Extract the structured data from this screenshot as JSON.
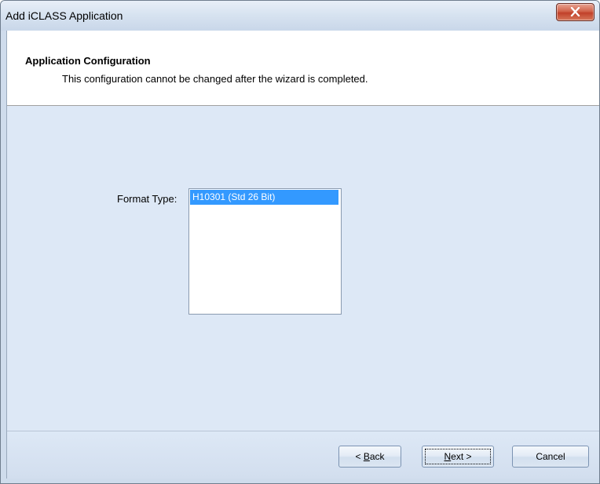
{
  "window": {
    "title": "Add iCLASS Application"
  },
  "header": {
    "title": "Application Configuration",
    "subtitle": "This configuration cannot be changed after the wizard is completed."
  },
  "form": {
    "format_type_label": "Format Type:",
    "format_type_options": [
      "H10301 (Std 26 Bit)"
    ],
    "format_type_selected": "H10301 (Std 26 Bit)"
  },
  "buttons": {
    "back_prefix": "< ",
    "back_accel": "B",
    "back_rest": "ack",
    "next_accel": "N",
    "next_rest": "ext >",
    "cancel": "Cancel"
  },
  "colors": {
    "selection": "#3399ff",
    "close_button": "#c1412a"
  },
  "icons": {
    "close": "close-x-icon"
  }
}
